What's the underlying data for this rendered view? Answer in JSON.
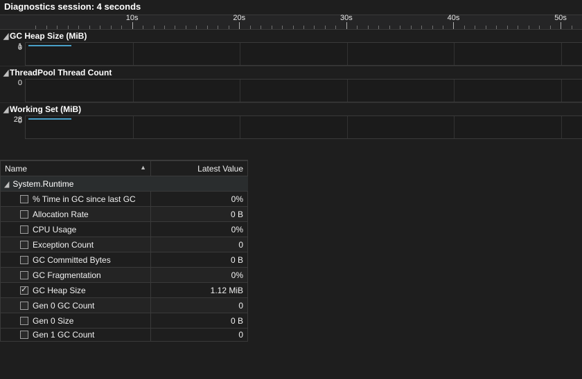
{
  "session": {
    "title": "Diagnostics session: 4 seconds"
  },
  "ruler": {
    "ticks": [
      "10s",
      "20s",
      "30s",
      "40s",
      "50s"
    ]
  },
  "charts": [
    {
      "title": "GC Heap Size (MiB)",
      "axis_top": "1",
      "axis_bottom": "0"
    },
    {
      "title": "ThreadPool Thread Count",
      "axis_top": "0",
      "axis_bottom": ""
    },
    {
      "title": "Working Set (MiB)",
      "axis_top": "28",
      "axis_bottom": "0"
    }
  ],
  "counters": {
    "header_name": "Name",
    "header_value": "Latest Value",
    "group": "System.Runtime",
    "rows": [
      {
        "name": "% Time in GC since last GC",
        "value": "0%",
        "checked": false
      },
      {
        "name": "Allocation Rate",
        "value": "0 B",
        "checked": false
      },
      {
        "name": "CPU Usage",
        "value": "0%",
        "checked": false
      },
      {
        "name": "Exception Count",
        "value": "0",
        "checked": false
      },
      {
        "name": "GC Committed Bytes",
        "value": "0 B",
        "checked": false
      },
      {
        "name": "GC Fragmentation",
        "value": "0%",
        "checked": false
      },
      {
        "name": "GC Heap Size",
        "value": "1.12 MiB",
        "checked": true
      },
      {
        "name": "Gen 0 GC Count",
        "value": "0",
        "checked": false
      },
      {
        "name": "Gen 0 Size",
        "value": "0 B",
        "checked": false
      },
      {
        "name": "Gen 1 GC Count",
        "value": "0",
        "checked": false
      }
    ]
  },
  "chart_data": [
    {
      "type": "line",
      "title": "GC Heap Size (MiB)",
      "ylabel": "",
      "ylim": [
        0,
        1
      ],
      "x": [
        0,
        4
      ],
      "series": [
        {
          "name": "GC Heap Size",
          "values": [
            1,
            1
          ]
        }
      ],
      "x_unit": "s",
      "x_max": 50
    },
    {
      "type": "line",
      "title": "ThreadPool Thread Count",
      "ylabel": "",
      "ylim": [
        0,
        0
      ],
      "x": [
        0,
        4
      ],
      "series": [
        {
          "name": "ThreadPool Thread Count",
          "values": [
            0,
            0
          ]
        }
      ],
      "x_unit": "s",
      "x_max": 50
    },
    {
      "type": "line",
      "title": "Working Set (MiB)",
      "ylabel": "",
      "ylim": [
        0,
        28
      ],
      "x": [
        0,
        4
      ],
      "series": [
        {
          "name": "Working Set",
          "values": [
            28,
            28
          ]
        }
      ],
      "x_unit": "s",
      "x_max": 50
    }
  ]
}
